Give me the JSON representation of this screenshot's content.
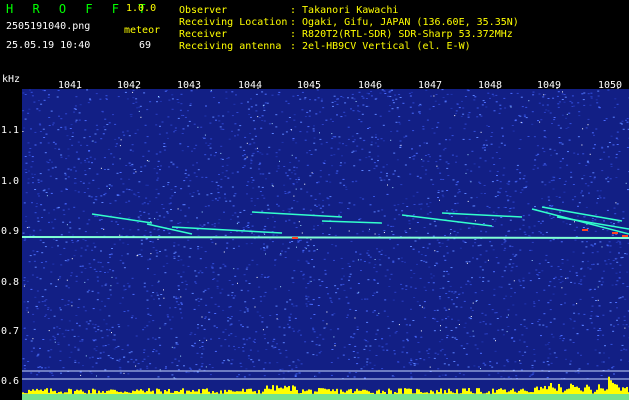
{
  "header": {
    "app_title": "H R O F F T",
    "version": "1.0.0",
    "filename": "2505191040.png",
    "datetime": "25.05.19 10:40",
    "meteor_label": "meteor",
    "meteor_count": "69",
    "info": [
      {
        "key": "Observer",
        "value": ": Takanori Kawachi"
      },
      {
        "key": "Receiving Location",
        "value": ": Ogaki, Gifu, JAPAN (136.60E, 35.35N)"
      },
      {
        "key": "Receiver",
        "value": ": R820T2(RTL-SDR) SDR-Sharp 53.372MHz"
      },
      {
        "key": "Receiving antenna",
        "value": ": 2el-HB9CV Vertical (el. E-W)"
      }
    ]
  },
  "axis": {
    "unit": "kHz",
    "y_ticks": [
      "1.1",
      "1.0",
      "0.9",
      "0.8",
      "0.7",
      "0.6"
    ],
    "x_ticks": [
      "1041",
      "1042",
      "1043",
      "1044",
      "1045",
      "1046",
      "1047",
      "1048",
      "1049",
      "1050"
    ]
  },
  "colors": {
    "background": "#000000",
    "noise_base": "#1a2a9e",
    "signal": "#00ffcc",
    "hot": "#ff3300",
    "level_bar": "#ffff00",
    "level_bar_low": "#00ccff",
    "title": "#00ff00",
    "label": "#ffff00"
  }
}
